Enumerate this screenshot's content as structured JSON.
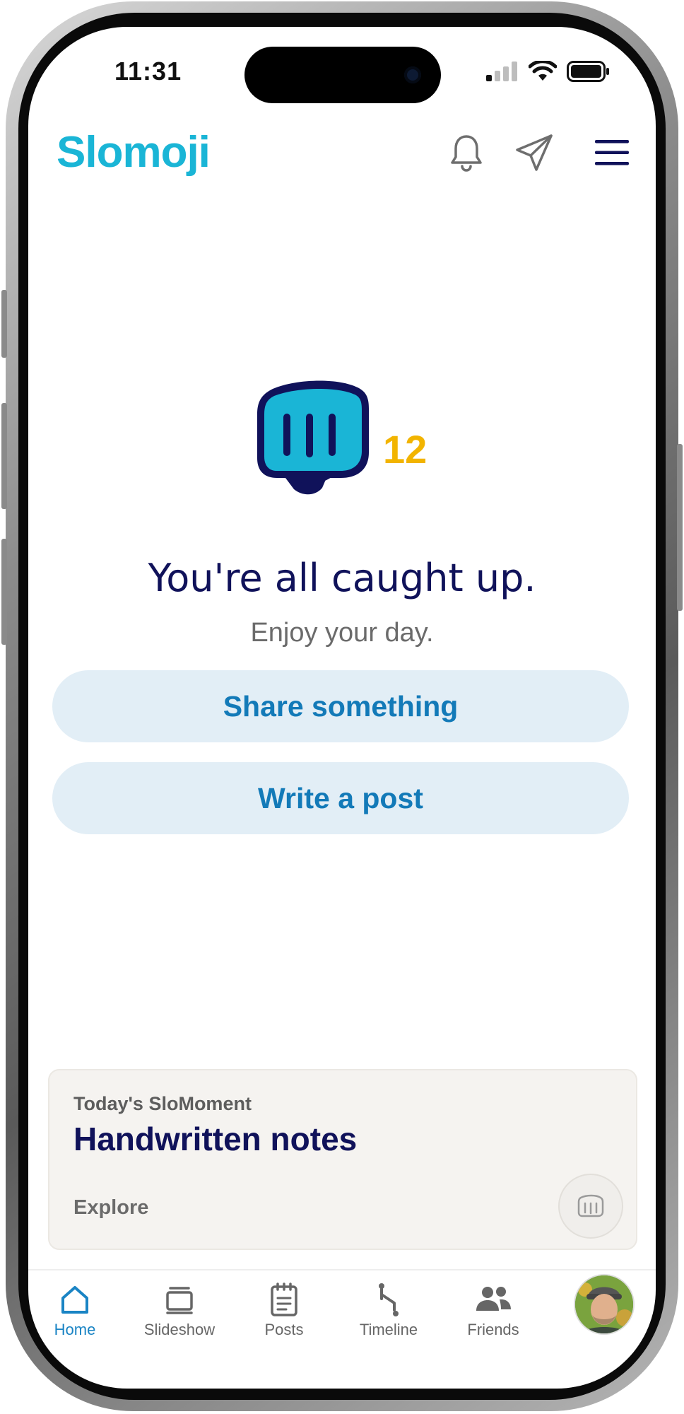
{
  "status_bar": {
    "time": "11:31",
    "icons": [
      "cellular-signal-icon",
      "wifi-icon",
      "battery-icon"
    ]
  },
  "header": {
    "logo_text": "Slomoji",
    "icons": [
      "bell-icon",
      "paper-plane-icon",
      "hamburger-menu-icon"
    ]
  },
  "hero": {
    "icon": "fist-bump-icon",
    "count": "12",
    "title": "You're all caught up.",
    "subtitle": "Enjoy your day."
  },
  "actions": {
    "share_label": "Share something",
    "write_label": "Write a post"
  },
  "moment": {
    "eyebrow": "Today's SloMoment",
    "title": "Handwritten notes",
    "link_label": "Explore",
    "react_icon": "fist-bump-icon"
  },
  "nav": {
    "items": [
      {
        "label": "Home",
        "icon": "home-icon",
        "active": true
      },
      {
        "label": "Slideshow",
        "icon": "slideshow-icon",
        "active": false
      },
      {
        "label": "Posts",
        "icon": "notepad-icon",
        "active": false
      },
      {
        "label": "Timeline",
        "icon": "timeline-icon",
        "active": false
      },
      {
        "label": "Friends",
        "icon": "friends-icon",
        "active": false
      }
    ],
    "profile_icon": "avatar"
  },
  "colors": {
    "brand": "#1ab5d6",
    "navy": "#10125a",
    "accent_blue": "#137ab8",
    "count_yellow": "#f2b400",
    "button_bg": "#e2eef6",
    "card_bg": "#f5f3f0"
  }
}
